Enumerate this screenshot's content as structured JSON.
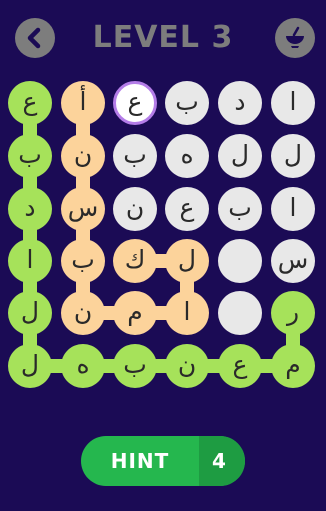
{
  "header": {
    "title": "LEVEL 3",
    "back_icon": "chevron-left-icon",
    "potion_icon": "potion-bowl-icon"
  },
  "colors": {
    "background": "#1b0b55",
    "green": "#a6e25a",
    "peach": "#fcd39b",
    "grey": "#e8e8e8",
    "selected_ring": "#b47de8",
    "button_grey": "#7d7d7d",
    "hint_green": "#25b74e"
  },
  "board": {
    "rows": [
      [
        {
          "letter": "ع",
          "state": "green"
        },
        {
          "letter": "أ",
          "state": "peach"
        },
        {
          "letter": "ع",
          "state": "selected"
        },
        {
          "letter": "ب",
          "state": "grey"
        },
        {
          "letter": "د",
          "state": "grey"
        },
        {
          "letter": "ا",
          "state": "grey"
        }
      ],
      [
        {
          "letter": "ب",
          "state": "green"
        },
        {
          "letter": "ن",
          "state": "peach"
        },
        {
          "letter": "ب",
          "state": "grey"
        },
        {
          "letter": "ه",
          "state": "grey"
        },
        {
          "letter": "ل",
          "state": "grey"
        },
        {
          "letter": "ل",
          "state": "grey"
        }
      ],
      [
        {
          "letter": "د",
          "state": "green"
        },
        {
          "letter": "س",
          "state": "peach"
        },
        {
          "letter": "ن",
          "state": "grey"
        },
        {
          "letter": "ع",
          "state": "grey"
        },
        {
          "letter": "ب",
          "state": "grey"
        },
        {
          "letter": "ا",
          "state": "grey"
        }
      ],
      [
        {
          "letter": "ا",
          "state": "green"
        },
        {
          "letter": "ب",
          "state": "peach"
        },
        {
          "letter": "ك",
          "state": "peach"
        },
        {
          "letter": "ل",
          "state": "peach"
        },
        {
          "letter": "",
          "state": "grey"
        },
        {
          "letter": "س",
          "state": "grey"
        }
      ],
      [
        {
          "letter": "ل",
          "state": "green"
        },
        {
          "letter": "ن",
          "state": "peach"
        },
        {
          "letter": "م",
          "state": "peach"
        },
        {
          "letter": "ا",
          "state": "peach"
        },
        {
          "letter": "",
          "state": "grey"
        },
        {
          "letter": "ر",
          "state": "green"
        }
      ],
      [
        {
          "letter": "ل",
          "state": "green"
        },
        {
          "letter": "ه",
          "state": "green"
        },
        {
          "letter": "ب",
          "state": "green"
        },
        {
          "letter": "ن",
          "state": "green"
        },
        {
          "letter": "ع",
          "state": "green"
        },
        {
          "letter": "م",
          "state": "green"
        }
      ]
    ],
    "paths": [
      {
        "color": "green",
        "cells": [
          [
            0,
            0
          ],
          [
            1,
            0
          ],
          [
            2,
            0
          ],
          [
            3,
            0
          ],
          [
            4,
            0
          ],
          [
            5,
            0
          ],
          [
            5,
            1
          ],
          [
            5,
            2
          ],
          [
            5,
            3
          ],
          [
            5,
            4
          ],
          [
            5,
            5
          ],
          [
            4,
            5
          ]
        ]
      },
      {
        "color": "peach",
        "cells": [
          [
            0,
            1
          ],
          [
            1,
            1
          ],
          [
            2,
            1
          ],
          [
            3,
            1
          ],
          [
            4,
            1
          ],
          [
            4,
            2
          ],
          [
            4,
            3
          ],
          [
            3,
            3
          ],
          [
            3,
            2
          ]
        ]
      }
    ]
  },
  "hint": {
    "label": "HINT",
    "count": "4"
  }
}
